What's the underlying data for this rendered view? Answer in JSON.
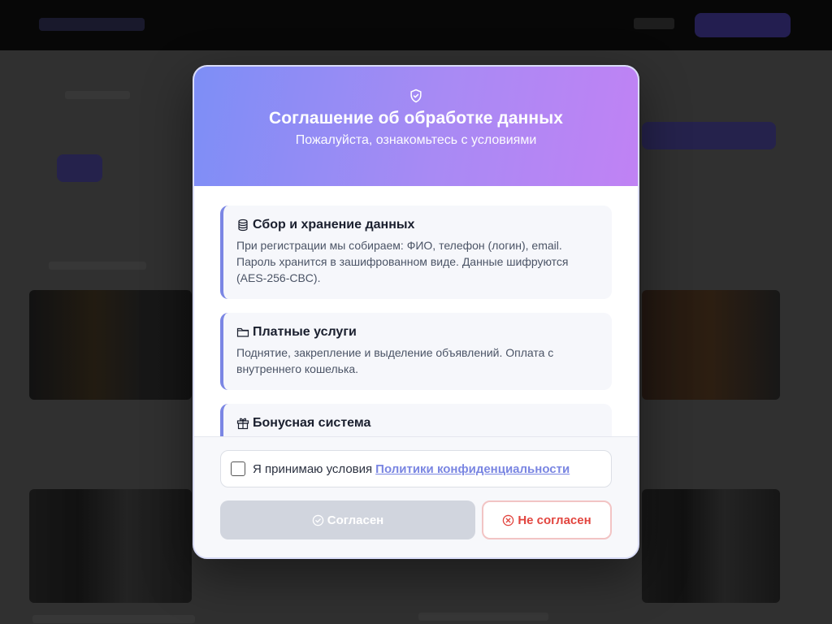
{
  "modal": {
    "title": "Соглашение об обработке данных",
    "subtitle": "Пожалуйста, ознакомьтесь с условиями",
    "sections": [
      {
        "icon": "database-icon",
        "title": "Сбор и хранение данных",
        "text": "При регистрации мы собираем: ФИО, телефон (логин), email. Пароль хранится в зашифрованном виде. Данные шифруются (AES-256-CBC)."
      },
      {
        "icon": "folder-icon",
        "title": "Платные услуги",
        "text": "Поднятие, закрепление и выделение объявлений. Оплата с внутреннего кошелька."
      },
      {
        "icon": "gift-icon",
        "title": "Бонусная система",
        "text": ""
      }
    ],
    "consent": {
      "text": "Я принимаю условия",
      "link_text": "Политики конфиденциальности",
      "checked": false
    },
    "buttons": {
      "agree_label": "Согласен",
      "agree_enabled": false,
      "disagree_label": "Не согласен"
    }
  },
  "colors": {
    "header_gradient_start": "#7d8ef6",
    "header_gradient_end": "#c082f4",
    "card_accent": "#7b86e4",
    "link": "#7a86e2",
    "agree_disabled": "#d1d5de",
    "disagree_text": "#e2453f"
  }
}
